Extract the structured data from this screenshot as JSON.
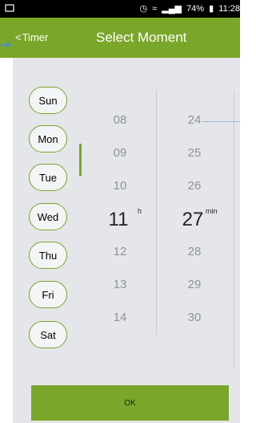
{
  "status_bar": {
    "battery": "74%",
    "time": "11:28",
    "icons": [
      "notification-icon",
      "alarm-icon",
      "wifi-icon",
      "signal-icon",
      "battery-icon"
    ]
  },
  "toolbar": {
    "back_label": "Timer",
    "title": "Select Moment"
  },
  "days": [
    "Sun",
    "Mon",
    "Tue",
    "Wed",
    "Thu",
    "Fri",
    "Sat"
  ],
  "hours": {
    "before": [
      "08",
      "09",
      "10"
    ],
    "selected": "11",
    "after": [
      "12",
      "13",
      "14"
    ],
    "unit": "h"
  },
  "minutes": {
    "before": [
      "24",
      "25",
      "26"
    ],
    "selected": "27",
    "after": [
      "28",
      "29",
      "30"
    ],
    "unit": "min"
  },
  "ok_label": "OK",
  "colors": {
    "accent": "#7aa629",
    "panel": "#e4e6ea",
    "callout": "#4a90c4"
  }
}
